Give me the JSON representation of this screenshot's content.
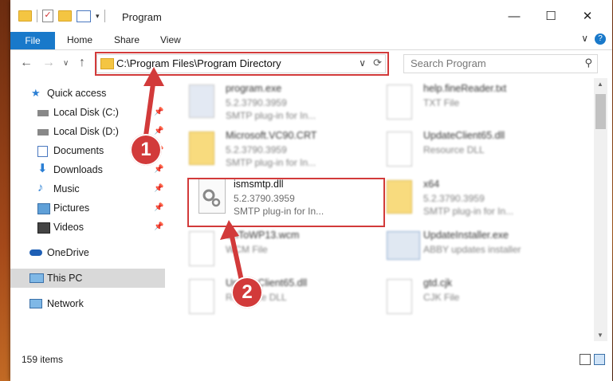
{
  "window": {
    "title": "Program"
  },
  "titlebar": {
    "minimize": "—",
    "maximize": "☐",
    "close": "✕"
  },
  "ribbon": {
    "tabs": [
      "File",
      "Home",
      "Share",
      "View"
    ],
    "help": "?"
  },
  "navbar": {
    "back": "←",
    "forward": "→",
    "recent": "∨",
    "up": "↑"
  },
  "address": {
    "path": "C:\\Program Files\\Program Directory",
    "dropdown": "∨",
    "refresh": "⟳"
  },
  "search": {
    "placeholder": "Search Program",
    "icon": "search-icon"
  },
  "sidebar": {
    "items": [
      {
        "label": "Quick access",
        "icon": "star-icon",
        "pinned": false
      },
      {
        "label": "Local Disk (C:)",
        "icon": "drive-icon",
        "pinned": true
      },
      {
        "label": "Local Disk (D:)",
        "icon": "drive-icon",
        "pinned": true
      },
      {
        "label": "Documents",
        "icon": "documents-icon",
        "pinned": true
      },
      {
        "label": "Downloads",
        "icon": "download-icon",
        "pinned": true
      },
      {
        "label": "Music",
        "icon": "music-icon",
        "pinned": true
      },
      {
        "label": "Pictures",
        "icon": "pictures-icon",
        "pinned": true
      },
      {
        "label": "Videos",
        "icon": "videos-icon",
        "pinned": true
      },
      {
        "label": "OneDrive",
        "icon": "cloud-icon",
        "pinned": false
      },
      {
        "label": "This PC",
        "icon": "computer-icon",
        "pinned": false,
        "selected": true
      },
      {
        "label": "Network",
        "icon": "network-icon",
        "pinned": false
      }
    ]
  },
  "files": [
    {
      "name": "program.exe",
      "line2": "5.2.3790.3959",
      "line3": "SMTP plug-in for In...",
      "icon": "exe-icon"
    },
    {
      "name": "help.fineReader.txt",
      "line2": "TXT File",
      "line3": "",
      "icon": "text-file-icon"
    },
    {
      "name": "Microsoft.VC90.CRT",
      "line2": "5.2.3790.3959",
      "line3": "SMTP plug-in for In...",
      "icon": "folder-file-icon"
    },
    {
      "name": "UpdateClient65.dll",
      "line2": "Resource DLL",
      "line3": "",
      "icon": "dll-icon"
    },
    {
      "name": "ismsmtp.dll",
      "line2": "5.2.3790.3959",
      "line3": "SMTP plug-in for In...",
      "icon": "dll-gear-icon"
    },
    {
      "name": "x64",
      "line2": "5.2.3790.3959",
      "line3": "SMTP plug-in for In...",
      "icon": "folder-file-icon"
    },
    {
      "name": "UnToWP13.wcm",
      "line2": "WCM File",
      "line3": "",
      "icon": "blank-file-icon"
    },
    {
      "name": "UpdateInstaller.exe",
      "line2": "ABBY updates installer",
      "line3": "",
      "icon": "installer-icon"
    },
    {
      "name": "UpdateClient65.dll",
      "line2": "Resource DLL",
      "line3": "",
      "icon": "dll-icon"
    },
    {
      "name": "gtd.cjk",
      "line2": "CJK File",
      "line3": "",
      "icon": "blank-file-icon"
    }
  ],
  "status": {
    "count": "159 items"
  },
  "annotations": {
    "badge1": "1",
    "badge2": "2",
    "accent": "#d23a3a"
  }
}
